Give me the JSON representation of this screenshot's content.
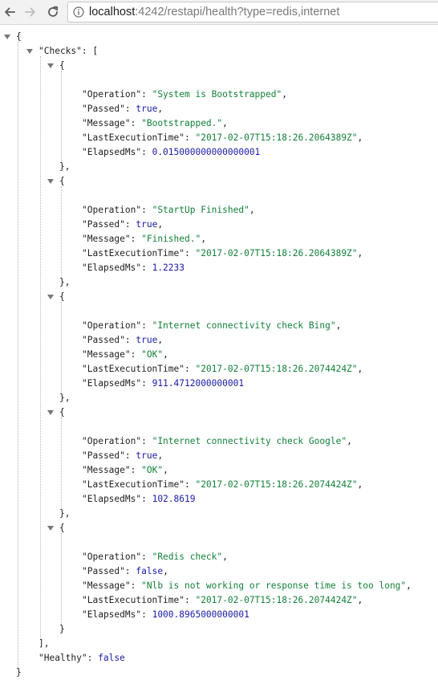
{
  "browser": {
    "url_host": "localhost",
    "url_rest": ":4242/restapi/health?type=redis,internet"
  },
  "json": {
    "checks_key": "\"Checks\"",
    "healthy_key": "\"Healthy\"",
    "healthy_value": "false",
    "field_keys": [
      "\"Operation\"",
      "\"Passed\"",
      "\"Message\"",
      "\"LastExecutionTime\"",
      "\"ElapsedMs\""
    ],
    "checks": [
      {
        "operation": "\"System is Bootstrapped\"",
        "passed": "true",
        "message": "\"Bootstrapped.\"",
        "last_execution_time": "\"2017-02-07T15:18:26.2064389Z\"",
        "elapsed_ms": "0.015000000000000001"
      },
      {
        "operation": "\"StartUp Finished\"",
        "passed": "true",
        "message": "\"Finished.\"",
        "last_execution_time": "\"2017-02-07T15:18:26.2064389Z\"",
        "elapsed_ms": "1.2233"
      },
      {
        "operation": "\"Internet connectivity check Bing\"",
        "passed": "true",
        "message": "\"OK\"",
        "last_execution_time": "\"2017-02-07T15:18:26.2074424Z\"",
        "elapsed_ms": "911.4712000000001"
      },
      {
        "operation": "\"Internet connectivity check Google\"",
        "passed": "true",
        "message": "\"OK\"",
        "last_execution_time": "\"2017-02-07T15:18:26.2074424Z\"",
        "elapsed_ms": "102.8619"
      },
      {
        "operation": "\"Redis check\"",
        "passed": "false",
        "message": "\"Nlb is not working or response time is too long\"",
        "last_execution_time": "\"2017-02-07T15:18:26.2074424Z\"",
        "elapsed_ms": "1000.8965000000001"
      }
    ]
  },
  "colors": {
    "string": "#13803a",
    "literal": "#1a1aa6",
    "key": "#222222"
  },
  "icons": [
    "back-arrow-icon",
    "forward-arrow-icon",
    "reload-icon",
    "info-icon",
    "collapse-triangle-icon"
  ]
}
